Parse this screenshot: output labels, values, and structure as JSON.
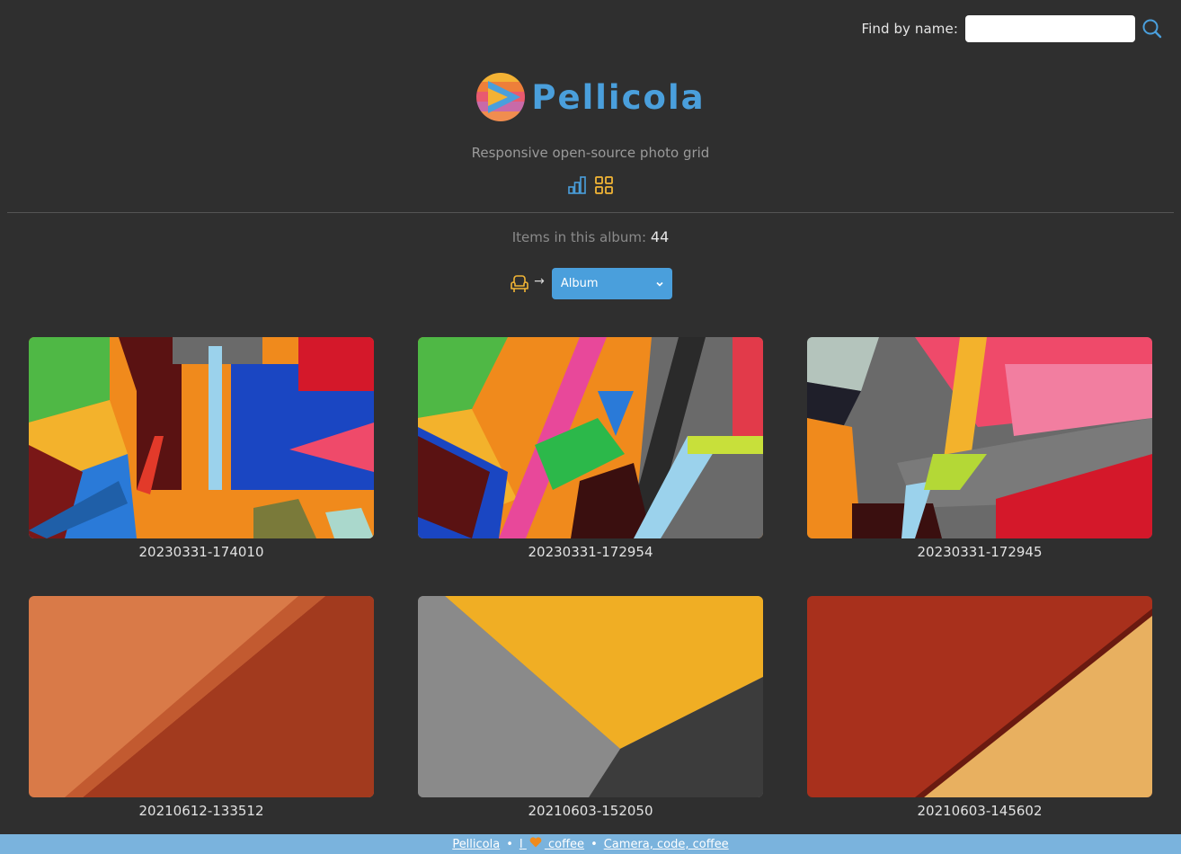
{
  "search": {
    "label": "Find by name:",
    "value": "",
    "placeholder": ""
  },
  "header": {
    "title": "Pellicola",
    "tagline": "Responsive open-source photo grid",
    "view_icons": [
      "bar-chart-icon",
      "grid-icon"
    ]
  },
  "album": {
    "count_label": "Items in this album:",
    "count": "44",
    "arrow": "→",
    "select_value": "Album"
  },
  "photos": [
    {
      "name": "20230331-174010"
    },
    {
      "name": "20230331-172954"
    },
    {
      "name": "20230331-172945"
    },
    {
      "name": "20210612-133512"
    },
    {
      "name": "20210603-152050"
    },
    {
      "name": "20210603-145602"
    }
  ],
  "footer": {
    "link1": "Pellicola",
    "sep": "•",
    "i_text": "I",
    "coffee": "coffee",
    "link3": "Camera, code, coffee"
  },
  "colors": {
    "accent": "#4a9fdc",
    "icon_yellow": "#f2b535",
    "footer_bg": "#7ab3dd"
  }
}
